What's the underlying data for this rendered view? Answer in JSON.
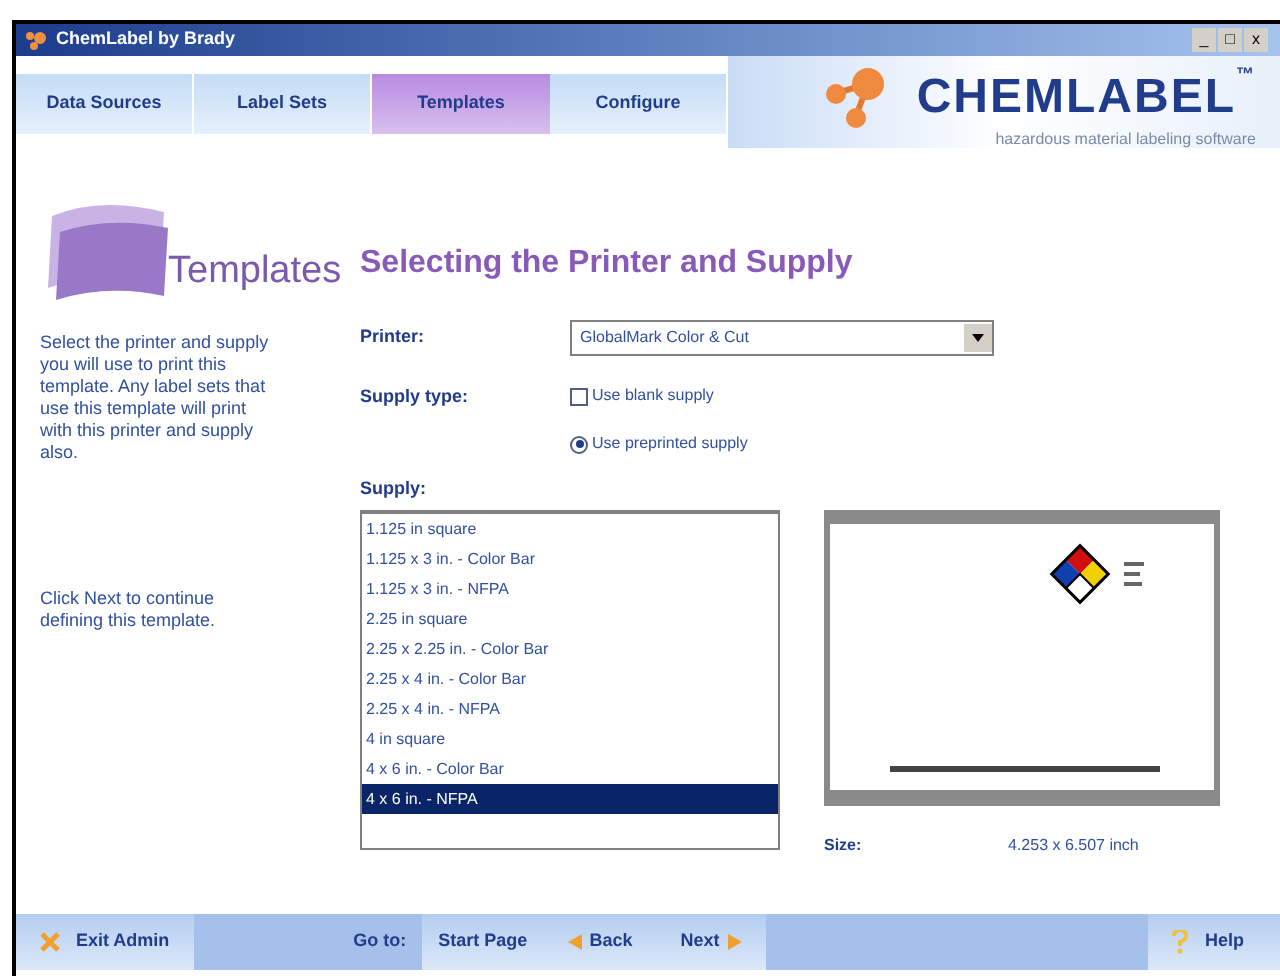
{
  "window": {
    "title": "ChemLabel by Brady",
    "controls": [
      "_",
      "□",
      "x"
    ]
  },
  "tabs": [
    {
      "label": "Data Sources",
      "selected": false
    },
    {
      "label": "Label Sets",
      "selected": false
    },
    {
      "label": "Templates",
      "selected": true
    },
    {
      "label": "Configure",
      "selected": false
    }
  ],
  "logo": {
    "name": "CHEMLABEL",
    "mark": "™",
    "tagline": "hazardous material labeling software"
  },
  "section": {
    "title": "Templates",
    "heading": "Selecting the Printer and Supply"
  },
  "help": [
    "Select the printer and supply you will use to print this template. Any label sets that use this template will print with this printer and supply also.",
    "Click Next to continue defining this template."
  ],
  "printer": {
    "label": "Printer:",
    "value": "GlobalMark Color & Cut"
  },
  "supply_type": {
    "label": "Supply type:",
    "options": [
      {
        "kind": "checkbox",
        "label": "Use blank supply",
        "selected": false
      },
      {
        "kind": "radio",
        "label": "Use preprinted supply",
        "selected": true
      }
    ]
  },
  "supply": {
    "label": "Supply:",
    "items": [
      {
        "label": "1.125 in square",
        "selected": false
      },
      {
        "label": "1.125 x 3 in. - Color Bar",
        "selected": false
      },
      {
        "label": "1.125 x 3 in. - NFPA",
        "selected": false
      },
      {
        "label": "2.25 in square",
        "selected": false
      },
      {
        "label": "2.25 x 2.25 in. - Color Bar",
        "selected": false
      },
      {
        "label": "2.25 x 4 in. - Color Bar",
        "selected": false
      },
      {
        "label": "2.25 x 4 in. - NFPA",
        "selected": false
      },
      {
        "label": "4 in square",
        "selected": false
      },
      {
        "label": "4 x 6 in. - Color Bar",
        "selected": false
      },
      {
        "label": "4 x 6 in. - NFPA",
        "selected": true
      }
    ]
  },
  "size": {
    "label": "Size:",
    "value": "4.253 x 6.507 inch"
  },
  "footer": {
    "exit": "Exit Admin",
    "goto": "Go to:",
    "start": "Start Page",
    "back": "Back",
    "next": "Next",
    "help": "Help"
  }
}
